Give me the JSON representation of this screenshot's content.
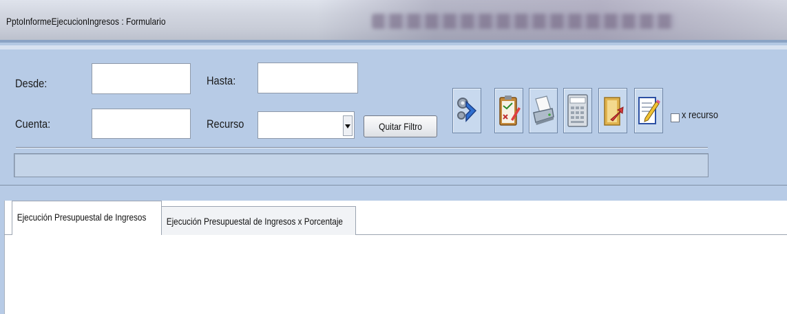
{
  "window": {
    "title": "PptoInformeEjecucionIngresos : Formulario"
  },
  "filters": {
    "desde_label": "Desde:",
    "desde_value": "",
    "hasta_label": "Hasta:",
    "hasta_value": "",
    "cuenta_label": "Cuenta:",
    "cuenta_value": "",
    "recurso_label": "Recurso",
    "recurso_value": "",
    "clear_button_label": "Quitar Filtro"
  },
  "toolbar": {
    "icons": [
      "run-gears-icon",
      "clipboard-edit-icon",
      "printer-icon",
      "calculator-icon",
      "export-folder-icon",
      "edit-document-icon"
    ],
    "checkbox_label": "x recurso",
    "checkbox_checked": false
  },
  "progress": {
    "value": 0
  },
  "tabs": [
    {
      "label": "Ejecución Presupuestal de Ingresos",
      "active": true
    },
    {
      "label": "Ejecución Presupuestal de Ingresos x Porcentaje",
      "active": false
    }
  ]
}
